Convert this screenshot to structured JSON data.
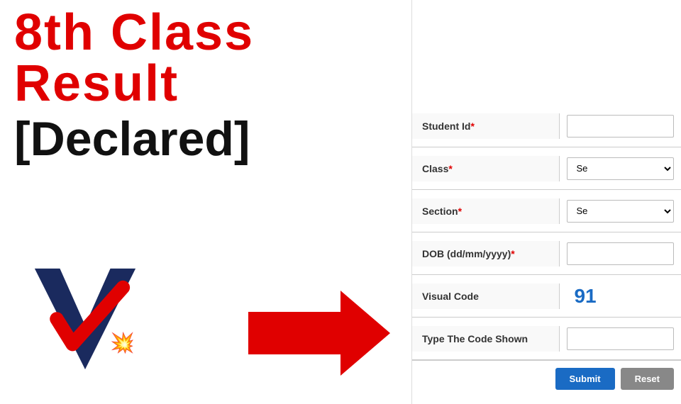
{
  "left": {
    "title": "8th Class Result",
    "declared": "[Declared]"
  },
  "form": {
    "rows": [
      {
        "label": "Student Id",
        "required": true,
        "type": "text",
        "placeholder": "",
        "name": "student-id-input"
      },
      {
        "label": "Class",
        "required": true,
        "type": "select",
        "placeholder": "Se",
        "name": "class-select"
      },
      {
        "label": "Section",
        "required": true,
        "type": "select",
        "placeholder": "Se",
        "name": "section-select"
      },
      {
        "label": "DOB (dd/mm/yyyy)",
        "required": true,
        "type": "text",
        "placeholder": "",
        "name": "dob-input"
      },
      {
        "label": "Visual Code",
        "required": false,
        "type": "visual",
        "value": "91",
        "name": "visual-code"
      },
      {
        "label": "Type The Code Shown",
        "required": false,
        "type": "text",
        "placeholder": "",
        "name": "code-input"
      }
    ],
    "buttons": {
      "submit": "Submit",
      "reset": "Reset"
    }
  }
}
